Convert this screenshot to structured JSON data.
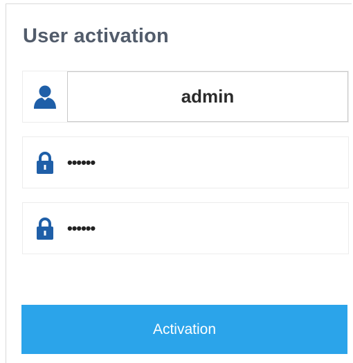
{
  "form": {
    "title": "User activation",
    "username": {
      "icon": "user-icon",
      "value": "admin"
    },
    "password": {
      "icon": "lock-icon",
      "masked_value": "••••••"
    },
    "confirm_password": {
      "icon": "lock-icon",
      "masked_value": "••••••"
    },
    "submit_label": "Activation"
  },
  "colors": {
    "accent": "#2ba4ea",
    "icon": "#1f5fa8",
    "title": "#525c6b"
  }
}
